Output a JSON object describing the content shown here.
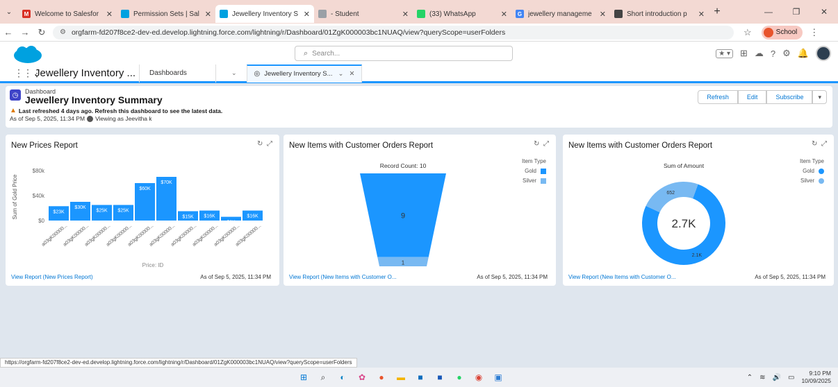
{
  "browser": {
    "tabs": [
      {
        "title": "Welcome to Salesfor",
        "favicon": "M",
        "favcolor": "#d93025",
        "active": false
      },
      {
        "title": "Permission Sets | Sal",
        "favicon": "",
        "favcolor": "#00a1e0",
        "active": false
      },
      {
        "title": "Jewellery Inventory S",
        "favicon": "",
        "favcolor": "#00a1e0",
        "active": true
      },
      {
        "title": "- Student",
        "favicon": "",
        "favcolor": "#9aa0a6",
        "active": false
      },
      {
        "title": "(33) WhatsApp",
        "favicon": "",
        "favcolor": "#25d366",
        "active": false
      },
      {
        "title": "jewellery manageme",
        "favicon": "G",
        "favcolor": "#4285f4",
        "active": false
      },
      {
        "title": "Short introduction p",
        "favicon": "",
        "favcolor": "#444",
        "active": false
      }
    ],
    "url": "orgfarm-fd207f8ce2-dev-ed.develop.lightning.force.com/lightning/r/Dashboard/01ZgK000003bc1NUAQ/view?queryScope=userFolders",
    "profile_label": "School",
    "status_url": "https://orgfarm-fd207f8ce2-dev-ed.develop.lightning.force.com/lightning/r/Dashboard/01ZgK000003bc1NUAQ/view?queryScope=userFolders"
  },
  "sf": {
    "search_placeholder": "Search...",
    "app_name": "Jewellery Inventory ...",
    "nav_dashboards": "Dashboards",
    "nav_tab": "Jewellery Inventory S..."
  },
  "dashboard": {
    "type_label": "Dashboard",
    "title": "Jewellery Inventory Summary",
    "refresh_notice": "Last refreshed 4 days ago. Refresh this dashboard to see the latest data.",
    "as_of": "As of Sep 5, 2025, 11:34 PM",
    "viewing_as": "Viewing as Jeevitha k",
    "buttons": {
      "refresh": "Refresh",
      "edit": "Edit",
      "subscribe": "Subscribe"
    }
  },
  "cards": [
    {
      "title": "New Prices Report",
      "link": "View Report (New Prices Report)",
      "date": "As of Sep 5, 2025, 11:34 PM"
    },
    {
      "title": "New Items with Customer Orders Report",
      "link": "View Report (New Items with Customer O...",
      "date": "As of Sep 5, 2025, 11:34 PM",
      "legend_title": "Item Type",
      "legend": [
        "Gold",
        "Silver"
      ],
      "chart_label": "Record Count: 10"
    },
    {
      "title": "New Items with Customer Orders Report",
      "link": "View Report (New Items with Customer O...",
      "date": "As of Sep 5, 2025, 11:34 PM",
      "legend_title": "Item Type",
      "legend": [
        "Gold",
        "Silver"
      ],
      "chart_label": "Sum of Amount",
      "center_label": "2.7K"
    }
  ],
  "chart_data": [
    {
      "type": "bar",
      "title": "New Prices Report",
      "xlabel": "Price: ID",
      "ylabel": "Sum of Gold Price",
      "yticks": [
        "$0",
        "$40k",
        "$80k"
      ],
      "ylim": [
        0,
        80000
      ],
      "categories": [
        "a03gK00000...",
        "a03gK00000...",
        "a03gK00000...",
        "a03gK00000...",
        "a03gK00000...",
        "a03gK00000...",
        "a03gK00000...",
        "a03gK00000...",
        "a03gK00000...",
        "a03gK00000..."
      ],
      "values": [
        23000,
        30000,
        25000,
        25000,
        60000,
        70000,
        15000,
        16000,
        6000,
        16000
      ],
      "labels": [
        "$23K",
        "$30K",
        "$25K",
        "$25K",
        "$60K",
        "$70K",
        "$15K",
        "$16K",
        "$6K",
        "$16K"
      ],
      "color": "#1b96ff"
    },
    {
      "type": "funnel",
      "title": "Record Count: 10",
      "series": [
        {
          "name": "Gold",
          "value": 9,
          "color": "#1b96ff"
        },
        {
          "name": "Silver",
          "value": 1,
          "color": "#78b9f2"
        }
      ]
    },
    {
      "type": "pie",
      "title": "Sum of Amount",
      "center": "2.7K",
      "series": [
        {
          "name": "Gold",
          "value": 2100,
          "label": "2.1K",
          "color": "#1b96ff"
        },
        {
          "name": "Silver",
          "value": 652,
          "label": "652",
          "color": "#78b9f2"
        }
      ]
    }
  ],
  "taskbar": {
    "time": "9:10 PM",
    "date": "10/09/2025"
  }
}
